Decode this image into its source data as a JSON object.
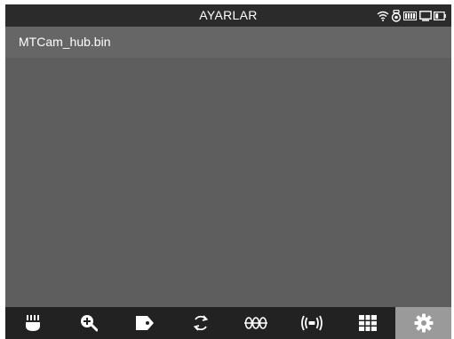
{
  "window": {
    "title": "AYARLAR"
  },
  "status_icons": [
    "wifi-icon",
    "camera-icon",
    "battery-icon",
    "display-icon",
    "battery-small-icon"
  ],
  "files": [
    {
      "name": "MTCam_hub.bin"
    }
  ],
  "toolbar": {
    "items": [
      {
        "icon": "brush-icon",
        "active": false
      },
      {
        "icon": "zoom-in-icon",
        "active": false
      },
      {
        "icon": "tag-icon",
        "active": false
      },
      {
        "icon": "rotate-icon",
        "active": false
      },
      {
        "icon": "strike-symbol-icon",
        "active": false
      },
      {
        "icon": "signal-icon",
        "active": false
      },
      {
        "icon": "grid-icon",
        "active": false
      },
      {
        "icon": "gear-icon",
        "active": true
      }
    ],
    "active_color": "#9a9a9a"
  },
  "colors": {
    "titlebar": "#2b2b2b",
    "background": "#5e5e5e",
    "toolbar": "#222222"
  }
}
